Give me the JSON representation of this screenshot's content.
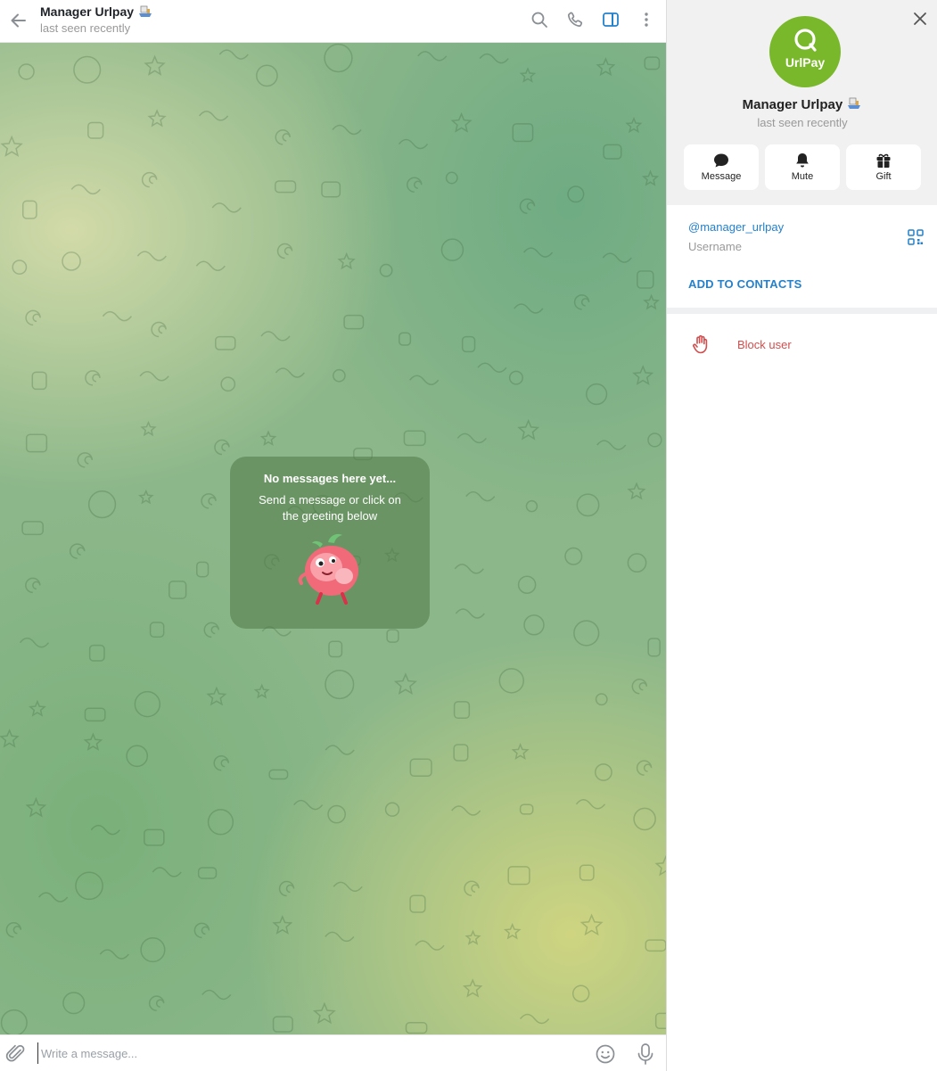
{
  "chat": {
    "title": "Manager Urlpay",
    "status": "last seen recently",
    "empty": {
      "title": "No messages here yet...",
      "subtitle": "Send a message or click on the greeting below"
    },
    "composer": {
      "placeholder": "Write a message..."
    }
  },
  "profile": {
    "name": "Manager Urlpay",
    "status": "last seen recently",
    "avatar_text": "UrlPay",
    "avatar_color": "#79b82a",
    "actions": [
      {
        "label": "Message",
        "icon": "message-icon"
      },
      {
        "label": "Mute",
        "icon": "bell-icon"
      },
      {
        "label": "Gift",
        "icon": "gift-icon"
      }
    ],
    "username": "@manager_urlpay",
    "username_caption": "Username",
    "add_contacts": "ADD TO CONTACTS",
    "block_label": "Block user"
  },
  "colors": {
    "accent": "#2481cc",
    "danger": "#d14e4e",
    "chat_bg": "#8cb78a"
  }
}
